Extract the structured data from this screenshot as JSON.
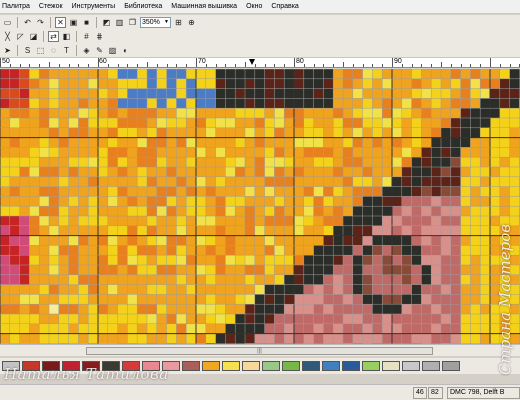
{
  "menu": [
    "Палитра",
    "Стежок",
    "Инструменты",
    "Библиотека",
    "Машинная вышивка",
    "Окно",
    "Справка"
  ],
  "toolbar1": {
    "icons": [
      "print-icon",
      "undo-icon",
      "redo-icon",
      "stitch-mode-icon",
      "symbol-mode-icon",
      "fill-square-icon",
      "half-stitch-icon",
      "fabric-view-icon",
      "layers-icon"
    ],
    "zoom_value": "350%",
    "icons_after": [
      "fit-page-icon",
      "zoom-in-icon"
    ]
  },
  "toolbar2": {
    "icons": [
      "full-stitch-icon",
      "quarter-stitch-icon",
      "three-quarter-stitch-icon",
      "color-swap-icon",
      "palette-icon",
      "grid-icon",
      "backstitch-grid-icon"
    ]
  },
  "toolbar3": {
    "icons": [
      "pointer-icon",
      "select-icon",
      "select-rect-icon",
      "select-lasso-icon",
      "text-icon",
      "fill-icon",
      "eyedropper-icon",
      "image-icon",
      "highlight-icon"
    ]
  },
  "ruler": {
    "labels": [
      "50",
      "60",
      "70",
      "80",
      "90"
    ]
  },
  "hscroll_grip": "|||",
  "palette_colors": [
    "#c4c4c4",
    "#c83828",
    "#7a1a1a",
    "#c02030",
    "#8a1c1c",
    "#3a3a30",
    "#d83a3a",
    "#e88890",
    "#e89aa0",
    "#a86058",
    "#f0a820",
    "#f5e050",
    "#f8d898",
    "#98c888",
    "#78b848",
    "#305878",
    "#4080c0",
    "#2a5a9a",
    "#98d060",
    "#e8e0c0",
    "#c8c8c8",
    "#b0b0b0",
    "#a0a0a0"
  ],
  "status": {
    "x": "46",
    "y": "82",
    "thread": "DMC  798, Delft B"
  },
  "watermark": {
    "bottom": "Наталья Татилова",
    "side": "Страна Мастеров"
  },
  "colors": {
    "black": "#2b2e28",
    "yellow": "#f5d21a",
    "lemon": "#f2e24a",
    "light_yellow": "#f7ec9a",
    "orange": "#f0a31c",
    "dark_orange": "#e8801e",
    "red_orange": "#d94a1c",
    "red": "#c62424",
    "dark_red": "#8e1212",
    "pink": "#d24a78",
    "blue": "#4c7cc6",
    "brown_dark": "#5c2418",
    "brown": "#8a4a38",
    "rose": "#c06a68",
    "light_rose": "#d8908a"
  }
}
